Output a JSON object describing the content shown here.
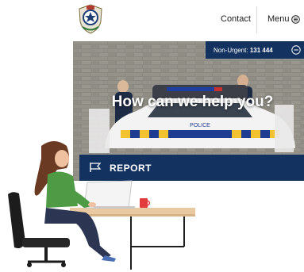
{
  "header": {
    "crest_icon": "police-crest-icon",
    "contact_label": "Contact",
    "menu_label": "Menu",
    "menu_icon": "menu-circle-icon"
  },
  "banner": {
    "nonurgent_label": "Non-Urgent:",
    "nonurgent_number": "131 444",
    "collapse_icon": "minus-circle-icon"
  },
  "hero": {
    "title": "How can we help you?",
    "car_text": "POLICE"
  },
  "report": {
    "label": "REPORT",
    "icon": "flag-icon"
  },
  "colors": {
    "navy": "#13325f",
    "text": "#1d1d1d"
  }
}
